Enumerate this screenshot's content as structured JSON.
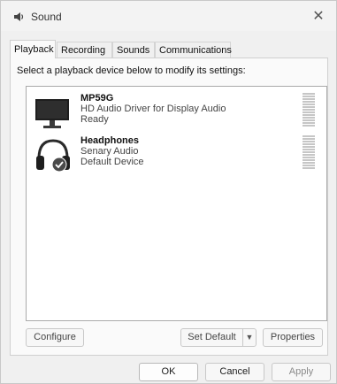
{
  "window": {
    "title": "Sound",
    "close_label": "✕"
  },
  "tabs": [
    {
      "label": "Playback",
      "active": true
    },
    {
      "label": "Recording",
      "active": false
    },
    {
      "label": "Sounds",
      "active": false
    },
    {
      "label": "Communications",
      "active": false
    }
  ],
  "playback": {
    "instruction": "Select a playback device below to modify its settings:",
    "devices": [
      {
        "name": "MP59G",
        "driver": "HD Audio Driver for Display Audio",
        "status": "Ready",
        "icon": "monitor-icon"
      },
      {
        "name": "Headphones",
        "driver": "Senary Audio",
        "status": "Default Device",
        "icon": "headphones-icon",
        "default": true
      }
    ]
  },
  "buttons": {
    "configure": "Configure",
    "set_default": "Set Default",
    "properties": "Properties",
    "ok": "OK",
    "cancel": "Cancel",
    "apply": "Apply"
  },
  "colors": {
    "accent_check": "#4a4a4a",
    "list_border": "#aaaaaa"
  }
}
